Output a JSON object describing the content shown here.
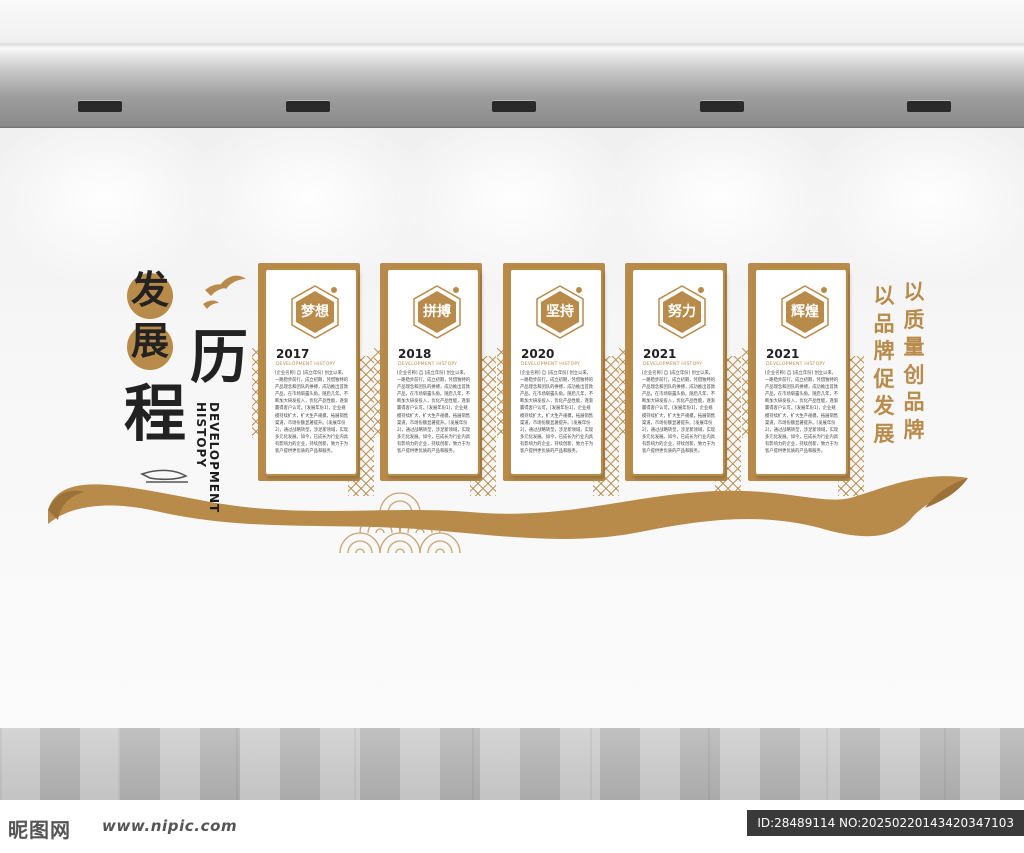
{
  "title": {
    "char_fa": "发",
    "char_zhan": "展",
    "char_li": "历",
    "char_cheng": "程",
    "english": "DEVELOPMENT HISTOPY"
  },
  "panels": [
    {
      "badge": "梦想",
      "year": "2017",
      "subtitle": "DEVELOPMENT HISTOPY",
      "text": "[企业名称] 自 [成立年份] 创立以来，一路稳步前行。成立初期，凭借独特的产品理念和团队的拼搏，成功推出首款产品，在市场崭露头角。随后几年，不断加大研发投入，优化产品性能，逐渐赢得客户认可。[发展年份1]，企业规模持续扩大，扩大生产规模，拓展销售渠道，市场份额显著提升。[发展年份2]，通过战略转型，涉足新领域，实现多元化发展。如今，已成长为行业内具有影响力的企业，持续创新，致力于为客户提供更优质的产品和服务。"
    },
    {
      "badge": "拼搏",
      "year": "2018",
      "subtitle": "DEVELOPMENT HISTOPY",
      "text": "[企业名称] 自 [成立年份] 创立以来，一路稳步前行。成立初期，凭借独特的产品理念和团队的拼搏，成功推出首款产品，在市场崭露头角。随后几年，不断加大研发投入，优化产品性能，逐渐赢得客户认可。[发展年份1]，企业规模持续扩大，扩大生产规模，拓展销售渠道，市场份额显著提升。[发展年份2]，通过战略转型，涉足新领域，实现多元化发展。如今，已成长为行业内具有影响力的企业，持续创新，致力于为客户提供更优质的产品和服务。"
    },
    {
      "badge": "坚持",
      "year": "2020",
      "subtitle": "DEVELOPMENT HISTOPY",
      "text": "[企业名称] 自 [成立年份] 创立以来，一路稳步前行。成立初期，凭借独特的产品理念和团队的拼搏，成功推出首款产品，在市场崭露头角。随后几年，不断加大研发投入，优化产品性能，逐渐赢得客户认可。[发展年份1]，企业规模持续扩大，扩大生产规模，拓展销售渠道，市场份额显著提升。[发展年份2]，通过战略转型，涉足新领域，实现多元化发展。如今，已成长为行业内具有影响力的企业，持续创新，致力于为客户提供更优质的产品和服务。"
    },
    {
      "badge": "努力",
      "year": "2021",
      "subtitle": "DEVELOPMENT HISTOPY",
      "text": "[企业名称] 自 [成立年份] 创立以来，一路稳步前行。成立初期，凭借独特的产品理念和团队的拼搏，成功推出首款产品，在市场崭露头角。随后几年，不断加大研发投入，优化产品性能，逐渐赢得客户认可。[发展年份1]，企业规模持续扩大，扩大生产规模，拓展销售渠道，市场份额显著提升。[发展年份2]，通过战略转型，涉足新领域，实现多元化发展。如今，已成长为行业内具有影响力的企业，持续创新，致力于为客户提供更优质的产品和服务。"
    },
    {
      "badge": "辉煌",
      "year": "2021",
      "subtitle": "DEVELOPMENT HISTOPY",
      "text": "[企业名称] 自 [成立年份] 创立以来，一路稳步前行。成立初期，凭借独特的产品理念和团队的拼搏，成功推出首款产品，在市场崭露头角。随后几年，不断加大研发投入，优化产品性能，逐渐赢得客户认可。[发展年份1]，企业规模持续扩大，扩大生产规模，拓展销售渠道，市场份额显著提升。[发展年份2]，通过战略转型，涉足新领域，实现多元化发展。如今，已成长为行业内具有影响力的企业，持续创新，致力于为客户提供更优质的产品和服务。"
    }
  ],
  "slogan": {
    "column_right": "以质量创品牌",
    "column_left": "以品牌促发展"
  },
  "watermark": {
    "logo": "昵图网",
    "url": "www.nipic.com",
    "id_text": "ID:28489114 NO:20250220143420347103"
  },
  "colors": {
    "accent": "#b88b4a",
    "title_text": "#222222",
    "wall": "#f5f5f5",
    "floor": "#b5b5b5"
  }
}
